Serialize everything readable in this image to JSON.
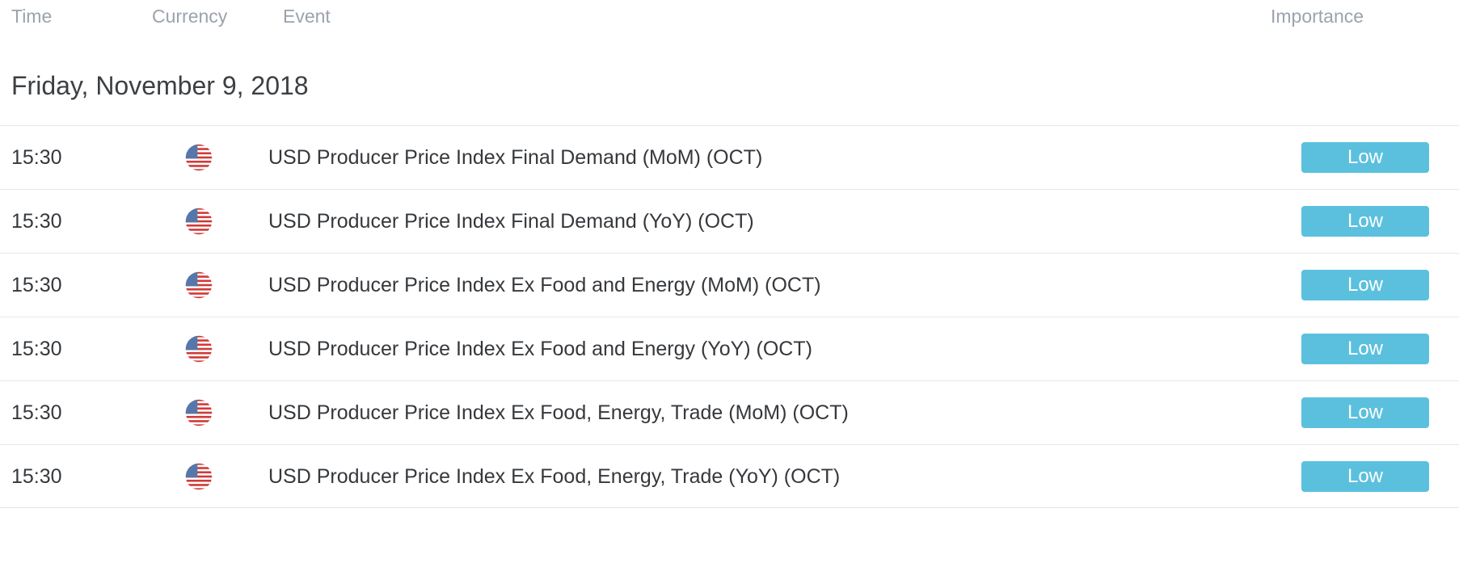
{
  "columns": {
    "time": "Time",
    "currency": "Currency",
    "event": "Event",
    "importance": "Importance"
  },
  "date_heading": "Friday, November 9, 2018",
  "colors": {
    "badge_low": "#5bc0de",
    "badge_text": "#ffffff",
    "header_text": "#9aa3ad",
    "row_text": "#35383c",
    "row_divider": "#e6e7e9",
    "background": "#ffffff"
  },
  "rows": [
    {
      "time": "15:30",
      "currency_icon": "flag-usa-icon",
      "currency_code": "USD",
      "event": "USD Producer Price Index Final Demand (MoM) (OCT)",
      "importance": "Low"
    },
    {
      "time": "15:30",
      "currency_icon": "flag-usa-icon",
      "currency_code": "USD",
      "event": "USD Producer Price Index Final Demand (YoY) (OCT)",
      "importance": "Low"
    },
    {
      "time": "15:30",
      "currency_icon": "flag-usa-icon",
      "currency_code": "USD",
      "event": "USD Producer Price Index Ex Food and Energy (MoM) (OCT)",
      "importance": "Low"
    },
    {
      "time": "15:30",
      "currency_icon": "flag-usa-icon",
      "currency_code": "USD",
      "event": "USD Producer Price Index Ex Food and Energy (YoY) (OCT)",
      "importance": "Low"
    },
    {
      "time": "15:30",
      "currency_icon": "flag-usa-icon",
      "currency_code": "USD",
      "event": "USD Producer Price Index Ex Food, Energy, Trade (MoM) (OCT)",
      "importance": "Low"
    },
    {
      "time": "15:30",
      "currency_icon": "flag-usa-icon",
      "currency_code": "USD",
      "event": "USD Producer Price Index Ex Food, Energy, Trade (YoY) (OCT)",
      "importance": "Low"
    }
  ]
}
